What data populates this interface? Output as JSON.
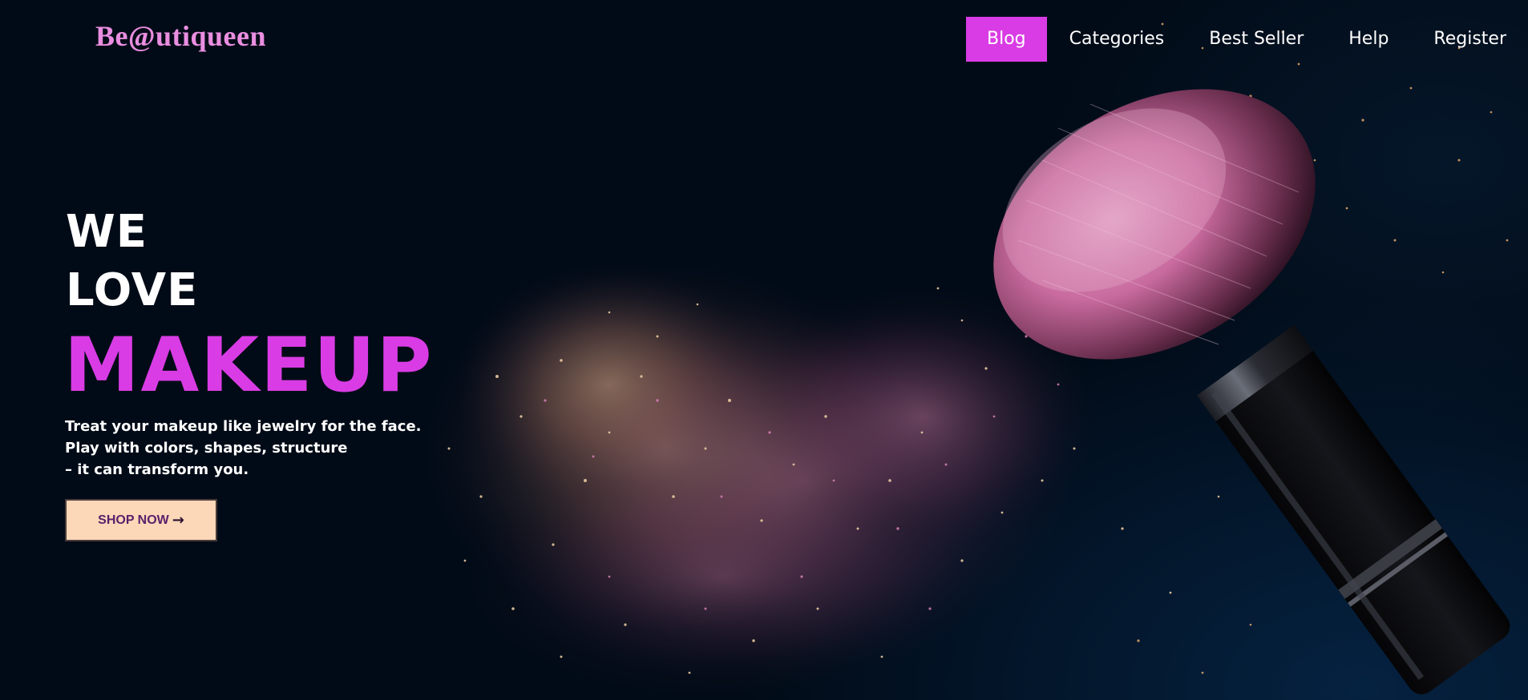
{
  "brand": {
    "logo_text": "Be@utiqueen"
  },
  "nav": {
    "items": [
      {
        "label": "Blog",
        "active": true
      },
      {
        "label": "Categories",
        "active": false
      },
      {
        "label": "Best Seller",
        "active": false
      },
      {
        "label": "Help",
        "active": false
      },
      {
        "label": "Register",
        "active": false
      }
    ]
  },
  "hero": {
    "headline_line1": "WE",
    "headline_line2": "LOVE",
    "headline_line3": "MAKEUP",
    "tagline": [
      "Treat your makeup like jewelry for the face.",
      "Play with colors, shapes, structure",
      "– it can transform you."
    ],
    "cta_label": "SHOP NOW",
    "cta_icon": "arrow-right-icon"
  },
  "colors": {
    "accent": "#d93ce4",
    "logo": "#e98ee0",
    "background": "#010b17",
    "cta_background": "#fcd8b8",
    "cta_text": "#5a1f6b"
  },
  "background_image": {
    "subject": "makeup brush with exploding pink and gold powder"
  }
}
